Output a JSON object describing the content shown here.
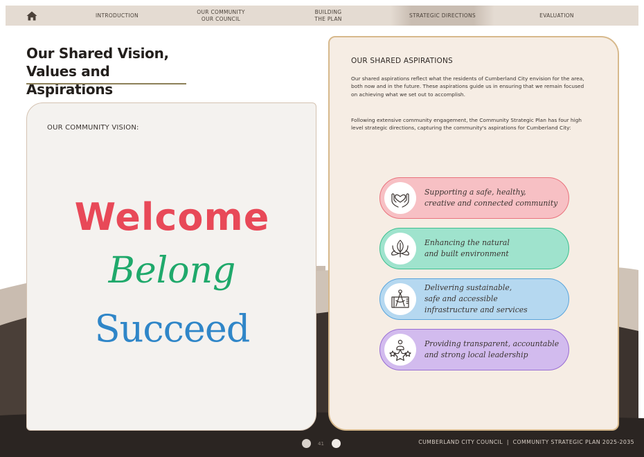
{
  "nav": {
    "items": [
      {
        "label": "INTRODUCTION"
      },
      {
        "label_line1": "OUR COMMUNITY",
        "label_line2": "OUR COUNCIL"
      },
      {
        "label_line1": "BUILDING",
        "label_line2": "THE PLAN"
      },
      {
        "label": "STRATEGIC DIRECTIONS",
        "active": true
      },
      {
        "label": "EVALUATION"
      }
    ]
  },
  "page": {
    "title_line1": "Our Shared Vision,",
    "title_line2": "Values and Aspirations"
  },
  "vision": {
    "label": "OUR COMMUNITY VISION:",
    "words": [
      "Welcome",
      "Belong",
      "Succeed"
    ],
    "colors": {
      "welcome": "#e84958",
      "belong": "#1fa96b",
      "succeed": "#2f86c8"
    }
  },
  "aspirations": {
    "title": "OUR SHARED ASPIRATIONS",
    "paragraph1": "Our shared aspirations reflect what the residents of Cumberland City envision for the area, both now and in the future. These aspirations guide us in ensuring that we remain focused on achieving what we set out to accomplish.",
    "paragraph2": "Following extensive community engagement, the Community Strategic Plan has four high level strategic directions, capturing the community's aspirations for Cumberland City:",
    "directions": [
      {
        "line1": "Supporting a safe, healthy,",
        "line2": "creative and connected community",
        "icon": "hands-heart-icon",
        "color": "#f7c0c4"
      },
      {
        "line1": "Enhancing the natural",
        "line2": "and built environment",
        "icon": "leaf-icon",
        "color": "#9fe3cd"
      },
      {
        "line1": "Delivering sustainable,",
        "line2": "safe and accessible",
        "line3": "infrastructure and services",
        "icon": "compass-blueprint-icon",
        "color": "#b5d8f0"
      },
      {
        "line1": "Providing transparent, accountable",
        "line2": "and strong local leadership",
        "icon": "leader-stars-icon",
        "color": "#d2bbee"
      }
    ]
  },
  "footer": {
    "page_number": "41",
    "text": "CUMBERLAND CITY COUNCIL  |  COMMUNITY STRATEGIC PLAN 2025-2035"
  }
}
